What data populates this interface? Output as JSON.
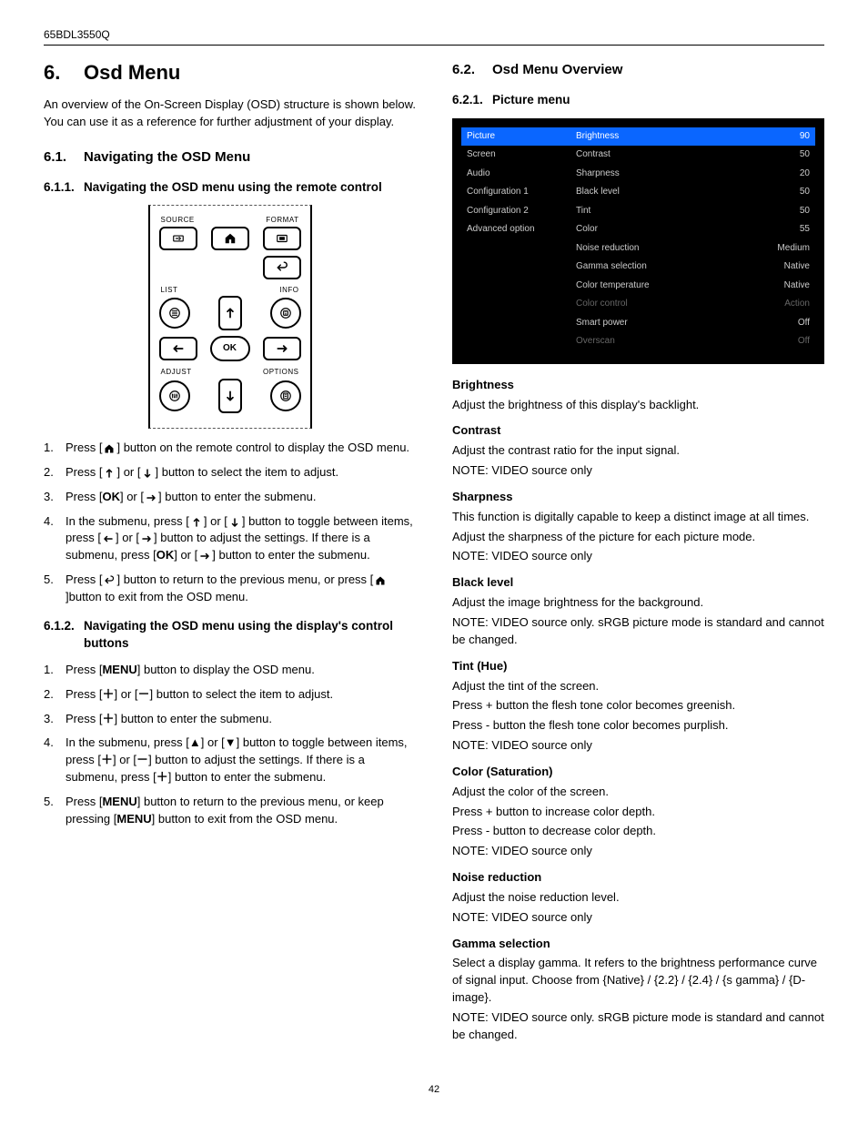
{
  "header": {
    "model": "65BDL3550Q"
  },
  "page_number": "42",
  "left": {
    "h1_num": "6.",
    "h1_title": "Osd Menu",
    "intro": "An overview of the On-Screen Display (OSD) structure is shown below. You can use it as a reference for further adjustment of your display.",
    "s61_num": "6.1.",
    "s61_title": "Navigating the OSD Menu",
    "s611_num": "6.1.1.",
    "s611_title": "Navigating the OSD menu using the remote control",
    "remote": {
      "source": "SOURCE",
      "format": "FORMAT",
      "list": "LIST",
      "info": "INFO",
      "ok": "OK",
      "adjust": "ADJUST",
      "options": "OPTIONS"
    },
    "steps_a": [
      "Press [HOME] button on the remote control to display the OSD menu.",
      "Press [UP] or [DOWN] button to select the item to adjust.",
      "Press [OK] or [RIGHT] button to enter the submenu.",
      "In the submenu, press [UP] or [DOWN] button to toggle between items, press [LEFT] or [RIGHT] button to adjust the settings. If there is a submenu, press [OK] or [RIGHT] button to enter the submenu.",
      "Press [BACK] button to return to the previous menu, or press [HOME]button to exit from the OSD menu."
    ],
    "s612_num": "6.1.2.",
    "s612_title": "Navigating the OSD menu using the display's control buttons",
    "steps_b": [
      "Press [MENU] button to display the OSD menu.",
      "Press [＋] or [－] button to select the item to adjust.",
      "Press [＋] button to enter the submenu.",
      "In the submenu, press [▲] or [▼] button to toggle between items, press [＋] or [－] button to adjust the settings. If there is a submenu, press [＋] button to enter the submenu.",
      "Press [MENU] button to return to the previous menu, or keep pressing [MENU] button to exit from the OSD menu."
    ]
  },
  "right": {
    "s62_num": "6.2.",
    "s62_title": "Osd Menu Overview",
    "s621_num": "6.2.1.",
    "s621_title": "Picture menu",
    "osd": {
      "left_items": [
        "Picture",
        "Screen",
        "Audio",
        "Configuration 1",
        "Configuration 2",
        "Advanced option"
      ],
      "right_items": [
        {
          "label": "Brightness",
          "value": "90",
          "hl": true
        },
        {
          "label": "Contrast",
          "value": "50"
        },
        {
          "label": "Sharpness",
          "value": "20"
        },
        {
          "label": "Black level",
          "value": "50"
        },
        {
          "label": "Tint",
          "value": "50"
        },
        {
          "label": "Color",
          "value": "55"
        },
        {
          "label": "Noise reduction",
          "value": "Medium"
        },
        {
          "label": "Gamma selection",
          "value": "Native"
        },
        {
          "label": "Color temperature",
          "value": "Native"
        },
        {
          "label": "Color control",
          "value": "Action",
          "dim": true
        },
        {
          "label": "Smart power",
          "value": "Off"
        },
        {
          "label": "Overscan",
          "value": "Off",
          "dim": true
        }
      ]
    },
    "defs": [
      {
        "term": "Brightness",
        "body": [
          "Adjust the brightness of this display's backlight."
        ]
      },
      {
        "term": "Contrast",
        "body": [
          "Adjust the contrast ratio for the input signal.",
          "NOTE: VIDEO source only"
        ]
      },
      {
        "term": "Sharpness",
        "body": [
          "This function is digitally capable to keep a distinct image at all times.",
          "Adjust the sharpness of the picture for each picture mode.",
          "NOTE: VIDEO source only"
        ]
      },
      {
        "term": "Black level",
        "body": [
          "Adjust the image brightness for the background.",
          "NOTE: VIDEO source only. sRGB picture mode is standard and cannot be changed."
        ]
      },
      {
        "term": "Tint (Hue)",
        "body": [
          "Adjust the tint of the screen.",
          "Press + button the flesh tone color becomes greenish.",
          "Press - button the flesh tone color becomes purplish.",
          "NOTE: VIDEO source only"
        ]
      },
      {
        "term": "Color (Saturation)",
        "body": [
          "Adjust the color of the screen.",
          "Press + button to increase color depth.",
          "Press - button to decrease color depth.",
          "NOTE: VIDEO source only"
        ]
      },
      {
        "term": "Noise reduction",
        "body": [
          "Adjust the noise reduction level.",
          "NOTE: VIDEO source only"
        ]
      },
      {
        "term": "Gamma selection",
        "body": [
          "Select a display gamma. It refers to the brightness performance curve of signal input. Choose from {Native} / {2.2} / {2.4} / {s gamma} / {D-image}.",
          "NOTE: VIDEO source only. sRGB picture mode is standard and cannot be changed."
        ]
      }
    ]
  }
}
